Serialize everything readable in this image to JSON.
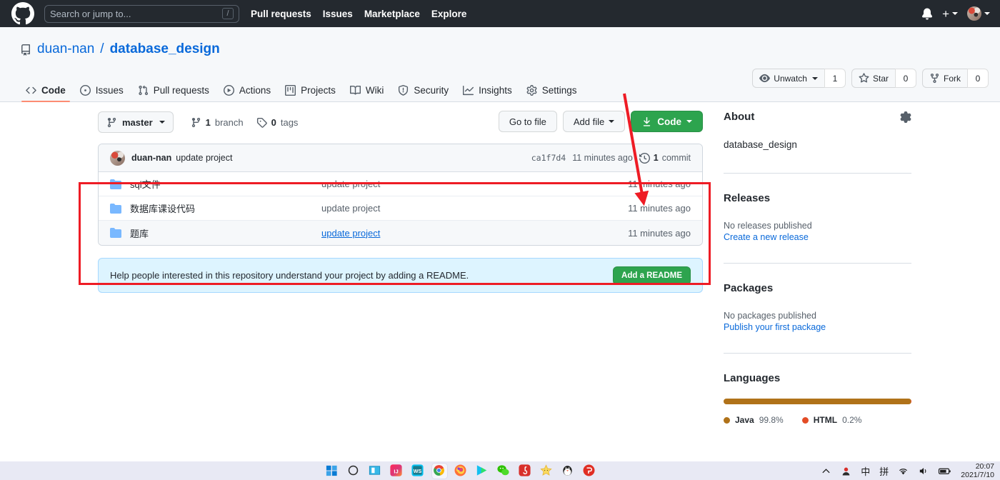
{
  "header": {
    "logo_icon": "github-mark-icon",
    "search": {
      "placeholder": "Search or jump to...",
      "shortcut": "/"
    },
    "nav": [
      {
        "label": "Pull requests"
      },
      {
        "label": "Issues"
      },
      {
        "label": "Marketplace"
      },
      {
        "label": "Explore"
      }
    ],
    "notifications_icon": "bell-icon",
    "plus_label": "+",
    "avatar_icon": "user-avatar"
  },
  "repo": {
    "owner": "duan-nan",
    "separator": "/",
    "name": "database_design",
    "repo_icon": "repo-icon",
    "actions": {
      "watch": {
        "label": "Unwatch",
        "count": "1",
        "icon": "eye-icon"
      },
      "star": {
        "label": "Star",
        "count": "0",
        "icon": "star-icon"
      },
      "fork": {
        "label": "Fork",
        "count": "0",
        "icon": "fork-icon"
      }
    },
    "tabs": [
      {
        "label": "Code",
        "icon": "code-icon",
        "active": true
      },
      {
        "label": "Issues",
        "icon": "issue-opened-icon",
        "active": false
      },
      {
        "label": "Pull requests",
        "icon": "git-pull-request-icon",
        "active": false
      },
      {
        "label": "Actions",
        "icon": "play-icon",
        "active": false
      },
      {
        "label": "Projects",
        "icon": "project-icon",
        "active": false
      },
      {
        "label": "Wiki",
        "icon": "book-icon",
        "active": false
      },
      {
        "label": "Security",
        "icon": "shield-icon",
        "active": false
      },
      {
        "label": "Insights",
        "icon": "graph-icon",
        "active": false
      },
      {
        "label": "Settings",
        "icon": "gear-icon",
        "active": false
      }
    ]
  },
  "toolbar": {
    "branch_label": "master",
    "branch_icon": "git-branch-icon",
    "branches": {
      "count": "1",
      "label": "branch",
      "icon": "git-branch-icon"
    },
    "tags": {
      "count": "0",
      "label": "tags",
      "icon": "tag-icon"
    },
    "go_to_file": "Go to file",
    "add_file": "Add file",
    "code_button": "Code",
    "code_icon": "download-icon"
  },
  "commit_bar": {
    "author": "duan-nan",
    "message": "update project",
    "sha": "ca1f7d4",
    "time": "11 minutes ago",
    "commits_count": "1",
    "commits_label": "commit",
    "history_icon": "history-icon"
  },
  "files": {
    "columns": [
      "name",
      "message",
      "time"
    ],
    "rows": [
      {
        "name": "sql文件",
        "icon": "folder-icon",
        "message": "update project",
        "message_is_link": false,
        "time": "11 minutes ago",
        "hovered": false
      },
      {
        "name": "数据库课设代码",
        "icon": "folder-icon",
        "message": "update project",
        "message_is_link": false,
        "time": "11 minutes ago",
        "hovered": false
      },
      {
        "name": "题库",
        "icon": "folder-icon",
        "message": "update project",
        "message_is_link": true,
        "time": "11 minutes ago",
        "hovered": true
      }
    ]
  },
  "readme_banner": {
    "text": "Help people interested in this repository understand your project by adding a README.",
    "button": "Add a README"
  },
  "sidebar": {
    "about": {
      "title": "About",
      "description": "database_design",
      "settings_icon": "gear-icon"
    },
    "releases": {
      "title": "Releases",
      "empty": "No releases published",
      "link": "Create a new release"
    },
    "packages": {
      "title": "Packages",
      "empty": "No packages published",
      "link": "Publish your first package"
    },
    "languages": {
      "title": "Languages",
      "items": [
        {
          "name": "Java",
          "percent": "99.8%",
          "value": 99.8,
          "color": "#b07219"
        },
        {
          "name": "HTML",
          "percent": "0.2%",
          "value": 0.2,
          "color": "#e34c26"
        }
      ]
    }
  },
  "annotations": {
    "highlight_color": "#ee1c25",
    "box_target": "file-list",
    "arrow_from": "settings-tab",
    "arrow_to": "first-file-row-time"
  },
  "taskbar": {
    "items": [
      {
        "name": "start-button",
        "label": ""
      },
      {
        "name": "search-button",
        "label": ""
      },
      {
        "name": "task-view-button",
        "label": ""
      },
      {
        "name": "intellij-idea-icon",
        "label": "IJ"
      },
      {
        "name": "webstorm-icon",
        "label": "WS"
      },
      {
        "name": "chrome-icon",
        "label": ""
      },
      {
        "name": "firefox-icon",
        "label": ""
      },
      {
        "name": "media-player-icon",
        "label": ""
      },
      {
        "name": "wechat-icon",
        "label": ""
      },
      {
        "name": "netease-music-icon",
        "label": ""
      },
      {
        "name": "star-app-icon",
        "label": ""
      },
      {
        "name": "qq-icon",
        "label": ""
      },
      {
        "name": "pinduoduo-icon",
        "label": ""
      }
    ],
    "tray": {
      "ime_mode": "中",
      "ime_method": "拼",
      "wifi_icon": "wifi-icon",
      "volume_icon": "speaker-icon",
      "battery_icon": "battery-icon",
      "time": "20:07",
      "date": "2021/7/10"
    }
  }
}
